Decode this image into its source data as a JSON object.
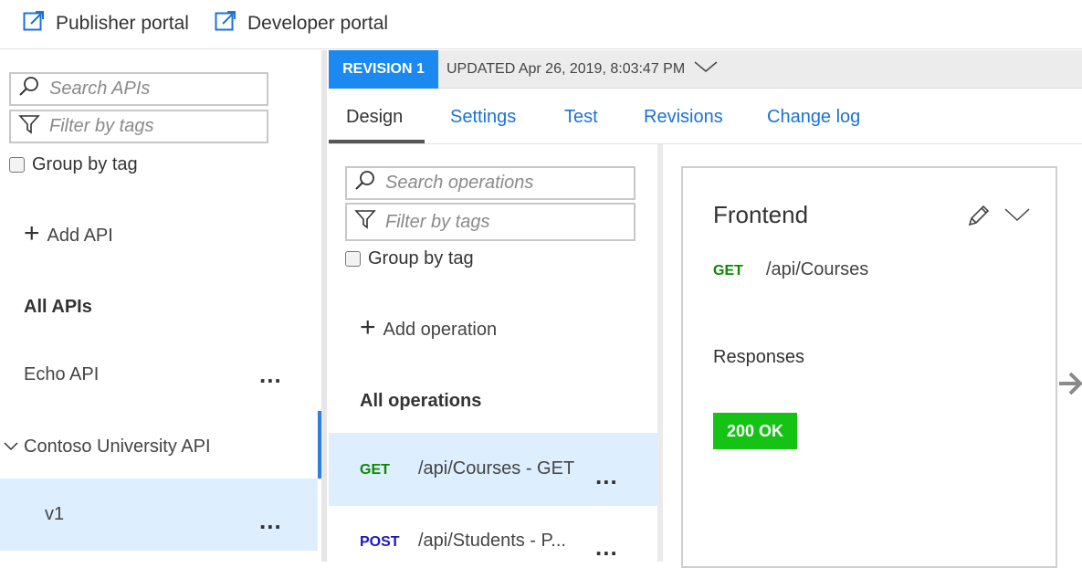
{
  "topbar": {
    "publisher_portal": "Publisher portal",
    "developer_portal": "Developer portal"
  },
  "left_panel": {
    "search_placeholder": "Search APIs",
    "filter_placeholder": "Filter by tags",
    "group_by_tag": "Group by tag",
    "add_api": "Add API",
    "section_title": "All APIs",
    "apis": [
      {
        "label": "Echo API",
        "more": "..."
      },
      {
        "label": "Contoso University API"
      }
    ],
    "version": {
      "label": "v1",
      "more": "..."
    }
  },
  "revision_bar": {
    "badge": "REVISION 1",
    "updated": "UPDATED Apr 26, 2019, 8:03:47 PM"
  },
  "tabs": [
    {
      "label": "Design",
      "active": true
    },
    {
      "label": "Settings"
    },
    {
      "label": "Test"
    },
    {
      "label": "Revisions"
    },
    {
      "label": "Change log"
    }
  ],
  "operations_panel": {
    "search_placeholder": "Search operations",
    "filter_placeholder": "Filter by tags",
    "group_by_tag": "Group by tag",
    "add_operation": "Add operation",
    "section_title": "All operations",
    "operations": [
      {
        "method": "GET",
        "path": "/api/Courses - GET",
        "more": "...",
        "selected": true
      },
      {
        "method": "POST",
        "path": "/api/Students - P...",
        "more": "..."
      }
    ]
  },
  "frontend_card": {
    "title": "Frontend",
    "method": "GET",
    "path": "/api/Courses",
    "responses_title": "Responses",
    "status_badge": "200 OK"
  },
  "colors": {
    "accent": "#1b89f0",
    "link": "#1b72d8",
    "get": "#0b8a00",
    "post": "#1a17c9",
    "ok": "#14c314",
    "selected": "#ddeeff"
  }
}
